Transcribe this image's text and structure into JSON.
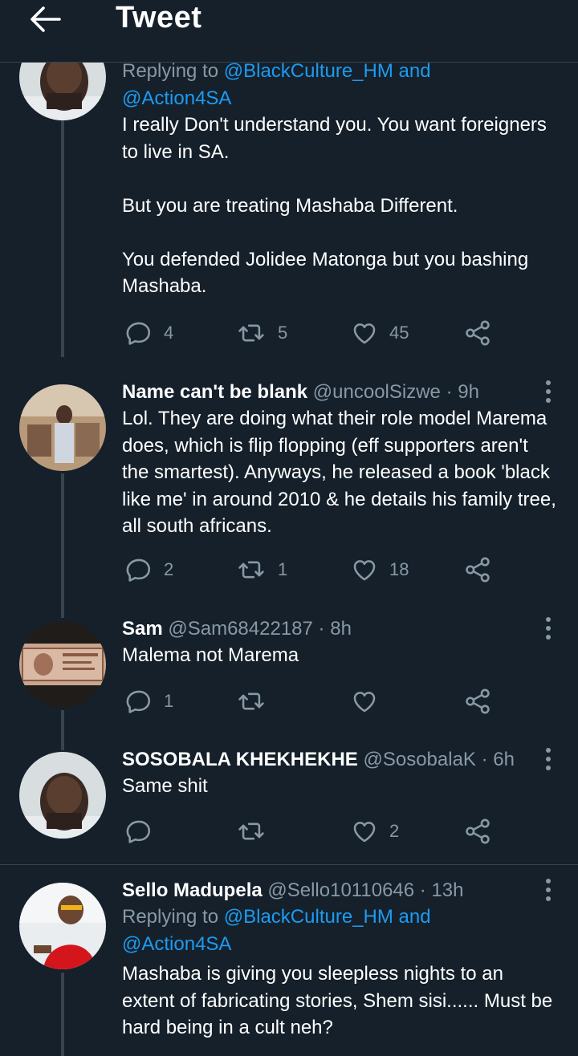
{
  "header": {
    "title": "Tweet"
  },
  "tweets": [
    {
      "reply_prefix": "Replying to ",
      "reply_to_1": "@BlackCulture_HM",
      "reply_and": " and",
      "reply_to_2": "@Action4SA",
      "text": [
        "I really Don't understand you. You want foreigners to live in SA.",
        "But you are treating Mashaba Different.",
        "You defended Jolidee Matonga but you bashing Mashaba."
      ],
      "replies": "4",
      "retweets": "5",
      "likes": "45"
    },
    {
      "name": "Name can't be blank",
      "handle": "@uncoolSizwe",
      "time": "9h",
      "text": [
        "Lol. They are doing what their role model Marema does, which is flip flopping (eff supporters aren't  the smartest). Anyways, he released a book 'black like me' in around 2010 & he details his family tree, all south africans."
      ],
      "replies": "2",
      "retweets": "1",
      "likes": "18"
    },
    {
      "name": "Sam",
      "handle": "@Sam68422187",
      "time": "8h",
      "text": [
        "Malema not Marema"
      ],
      "replies": "1",
      "retweets": "",
      "likes": ""
    },
    {
      "name": "SOSOBALA KHEKHEKHE",
      "handle": "@SosobalaK",
      "time": "6h",
      "text": [
        "Same shit"
      ],
      "replies": "",
      "retweets": "",
      "likes": "2"
    },
    {
      "name": "Sello Madupela",
      "handle": "@Sello10110646",
      "time": "13h",
      "reply_prefix": "Replying to ",
      "reply_to_1": "@BlackCulture_HM",
      "reply_and": " and",
      "reply_to_2": "@Action4SA",
      "text": [
        "Mashaba is giving you sleepless nights to an extent of fabricating stories, Shem sisi...... Must be hard being in a cult neh?"
      ]
    }
  ],
  "dot": "·",
  "colors": {
    "background": "#15202b",
    "link": "#1d9bf0",
    "muted": "#8899a6",
    "border": "#38444d"
  },
  "icons": [
    "back-arrow-icon",
    "reply-icon",
    "retweet-icon",
    "like-icon",
    "share-icon",
    "more-options-icon"
  ]
}
